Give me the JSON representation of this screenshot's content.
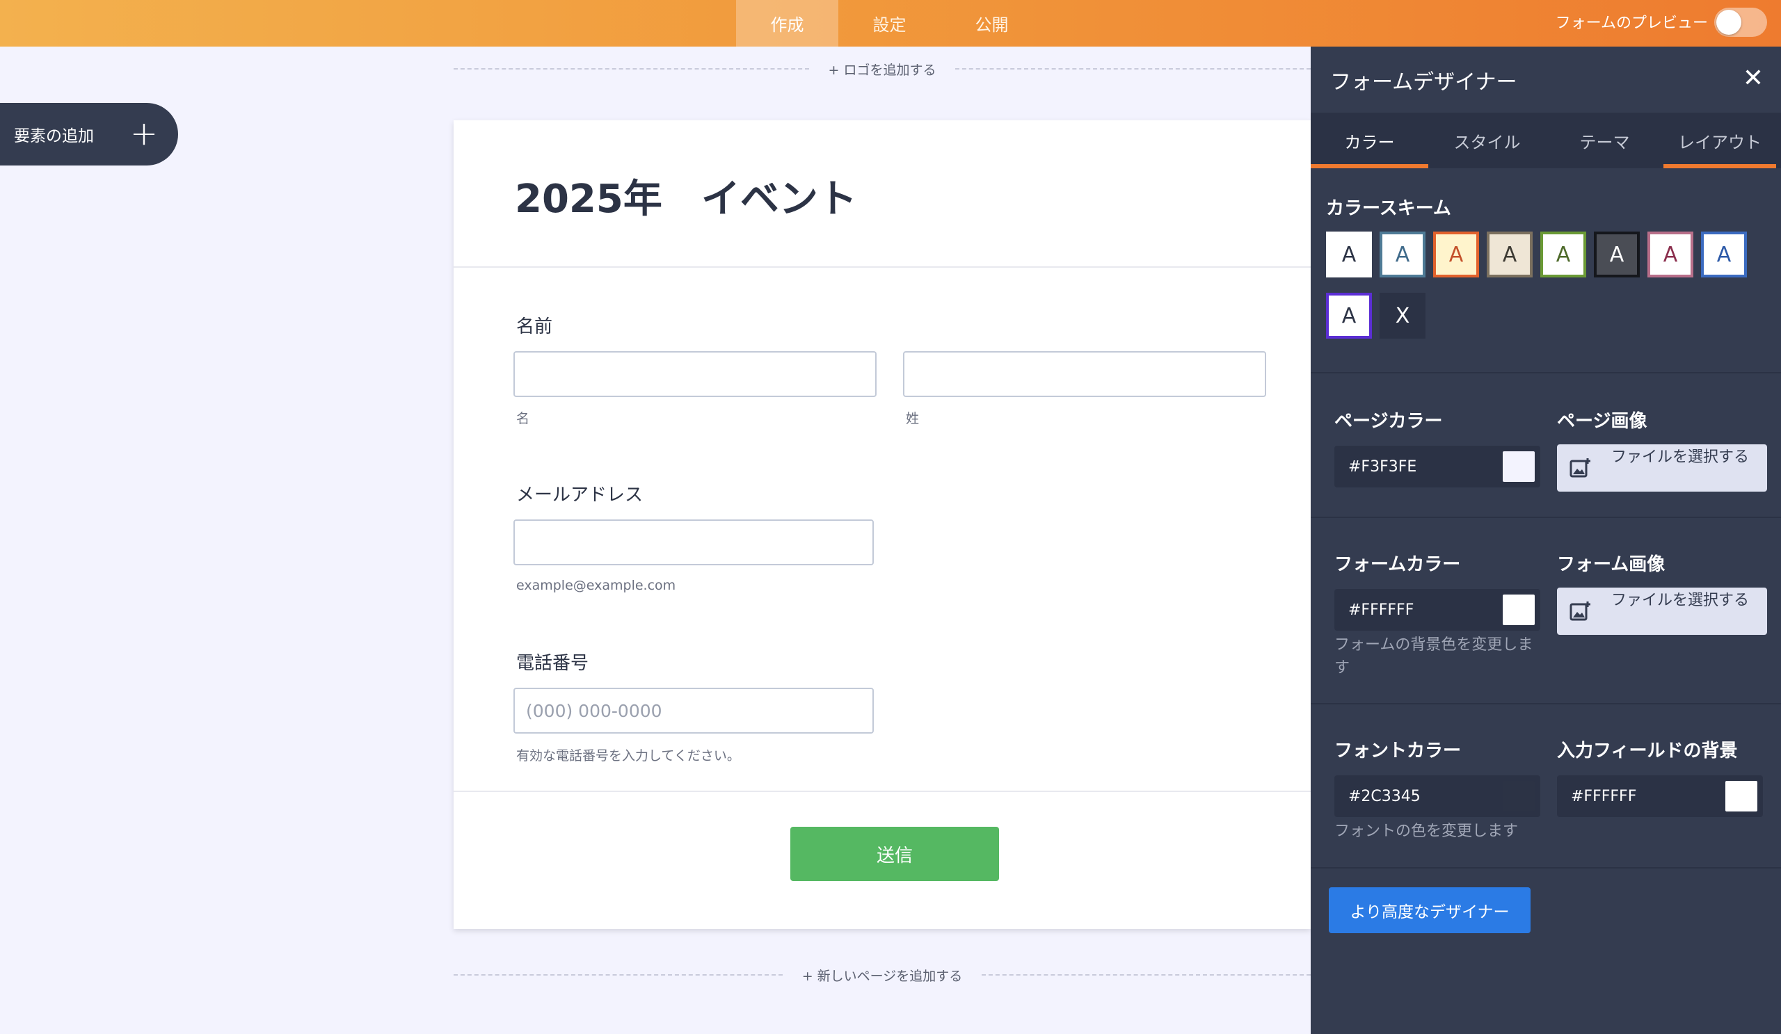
{
  "topbar": {
    "tabs": [
      {
        "label": "作成"
      },
      {
        "label": "設定"
      },
      {
        "label": "公開"
      }
    ],
    "preview_label": "フォームのプレビュー"
  },
  "add_element": {
    "label": "要素の追加",
    "plus": "+"
  },
  "canvas": {
    "add_logo": "+ ロゴを追加する",
    "add_page": "+ 新しいページを追加する"
  },
  "form": {
    "title": "2025年　イベント",
    "name": {
      "label": "名前",
      "first_sub": "名",
      "last_sub": "姓",
      "first_value": "",
      "last_value": ""
    },
    "email": {
      "label": "メールアドレス",
      "sub": "example@example.com",
      "value": ""
    },
    "phone": {
      "label": "電話番号",
      "placeholder": "(000) 000-0000",
      "sub": "有効な電話番号を入力してください。"
    },
    "submit": "送信"
  },
  "panel": {
    "title": "フォームデザイナー",
    "close": "✕",
    "tabs": [
      {
        "label": "カラー"
      },
      {
        "label": "スタイル"
      },
      {
        "label": "テーマ"
      },
      {
        "label": "レイアウト"
      }
    ],
    "color_scheme_heading": "カラースキーム",
    "swatches": [
      {
        "label": "A",
        "bg": "#ffffff",
        "fg": "#2c3345",
        "border": "#ffffff"
      },
      {
        "label": "A",
        "bg": "#ffffff",
        "fg": "#3f6a8a",
        "border": "#4f7b96"
      },
      {
        "label": "A",
        "bg": "#fff4cc",
        "fg": "#c4512a",
        "border": "#e2622c"
      },
      {
        "label": "A",
        "bg": "#efe6d6",
        "fg": "#3d3a33",
        "border": "#7c715f"
      },
      {
        "label": "A",
        "bg": "#ffffff",
        "fg": "#4e6a2a",
        "border": "#6b9a35"
      },
      {
        "label": "A",
        "bg": "#4a4d55",
        "fg": "#ffffff",
        "border": "#15171c"
      },
      {
        "label": "A",
        "bg": "#ffffff",
        "fg": "#8b2e4d",
        "border": "#b86f8a"
      },
      {
        "label": "A",
        "bg": "#ffffff",
        "fg": "#2d5aa8",
        "border": "#3b6bc0"
      },
      {
        "label": "A",
        "bg": "#ffffff",
        "fg": "#2c3345",
        "border": "#5b2ed4"
      },
      {
        "label": "X",
        "bg": "#2b3245",
        "fg": "#ffffff",
        "border": "#2b3245"
      }
    ],
    "page_color": {
      "heading": "ページカラー",
      "value": "#F3F3FE",
      "chip": "#f3f3fe"
    },
    "page_image": {
      "heading": "ページ画像",
      "button": "ファイルを選択する"
    },
    "form_color": {
      "heading": "フォームカラー",
      "value": "#FFFFFF",
      "chip": "#ffffff",
      "helper": "フォームの背景色を変更します"
    },
    "form_image": {
      "heading": "フォーム画像",
      "button": "ファイルを選択する"
    },
    "font_color": {
      "heading": "フォントカラー",
      "value": "#2C3345",
      "chip": "#2c3345",
      "helper": "フォントの色を変更します"
    },
    "input_bg": {
      "heading": "入力フィールドの背景",
      "value": "#FFFFFF",
      "chip": "#ffffff"
    },
    "advanced_button": "より高度なデザイナー"
  }
}
